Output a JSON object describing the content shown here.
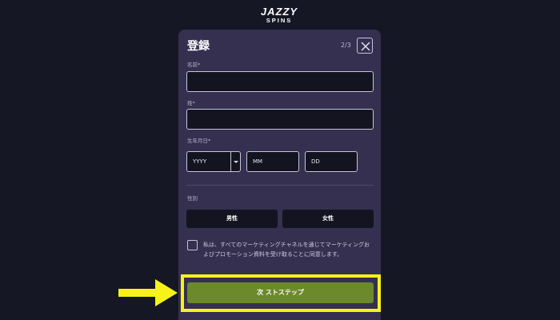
{
  "brand": {
    "line1": "JAZZY",
    "line2": "SPINS"
  },
  "modal": {
    "title": "登録",
    "step": "2/3",
    "close_icon": "close-icon"
  },
  "fields": {
    "first_name_label": "名前*",
    "last_name_label": "姓*",
    "dob_label": "生年月日*",
    "dob_year_placeholder": "YYYY",
    "dob_month_placeholder": "MM",
    "dob_day_placeholder": "DD",
    "gender_label": "性別",
    "gender_options": [
      "男性",
      "女性"
    ]
  },
  "consent_text": "私は、すべてのマーケティングチャネルを通じてマーケティングおよびプロモーション資料を受け取ることに同意します。",
  "next_button_label": "次 ストステップ",
  "colors": {
    "background": "#151724",
    "modal": "#35304f",
    "input": "#131420",
    "accent": "#6b8a2b",
    "highlight": "#f7f218"
  }
}
